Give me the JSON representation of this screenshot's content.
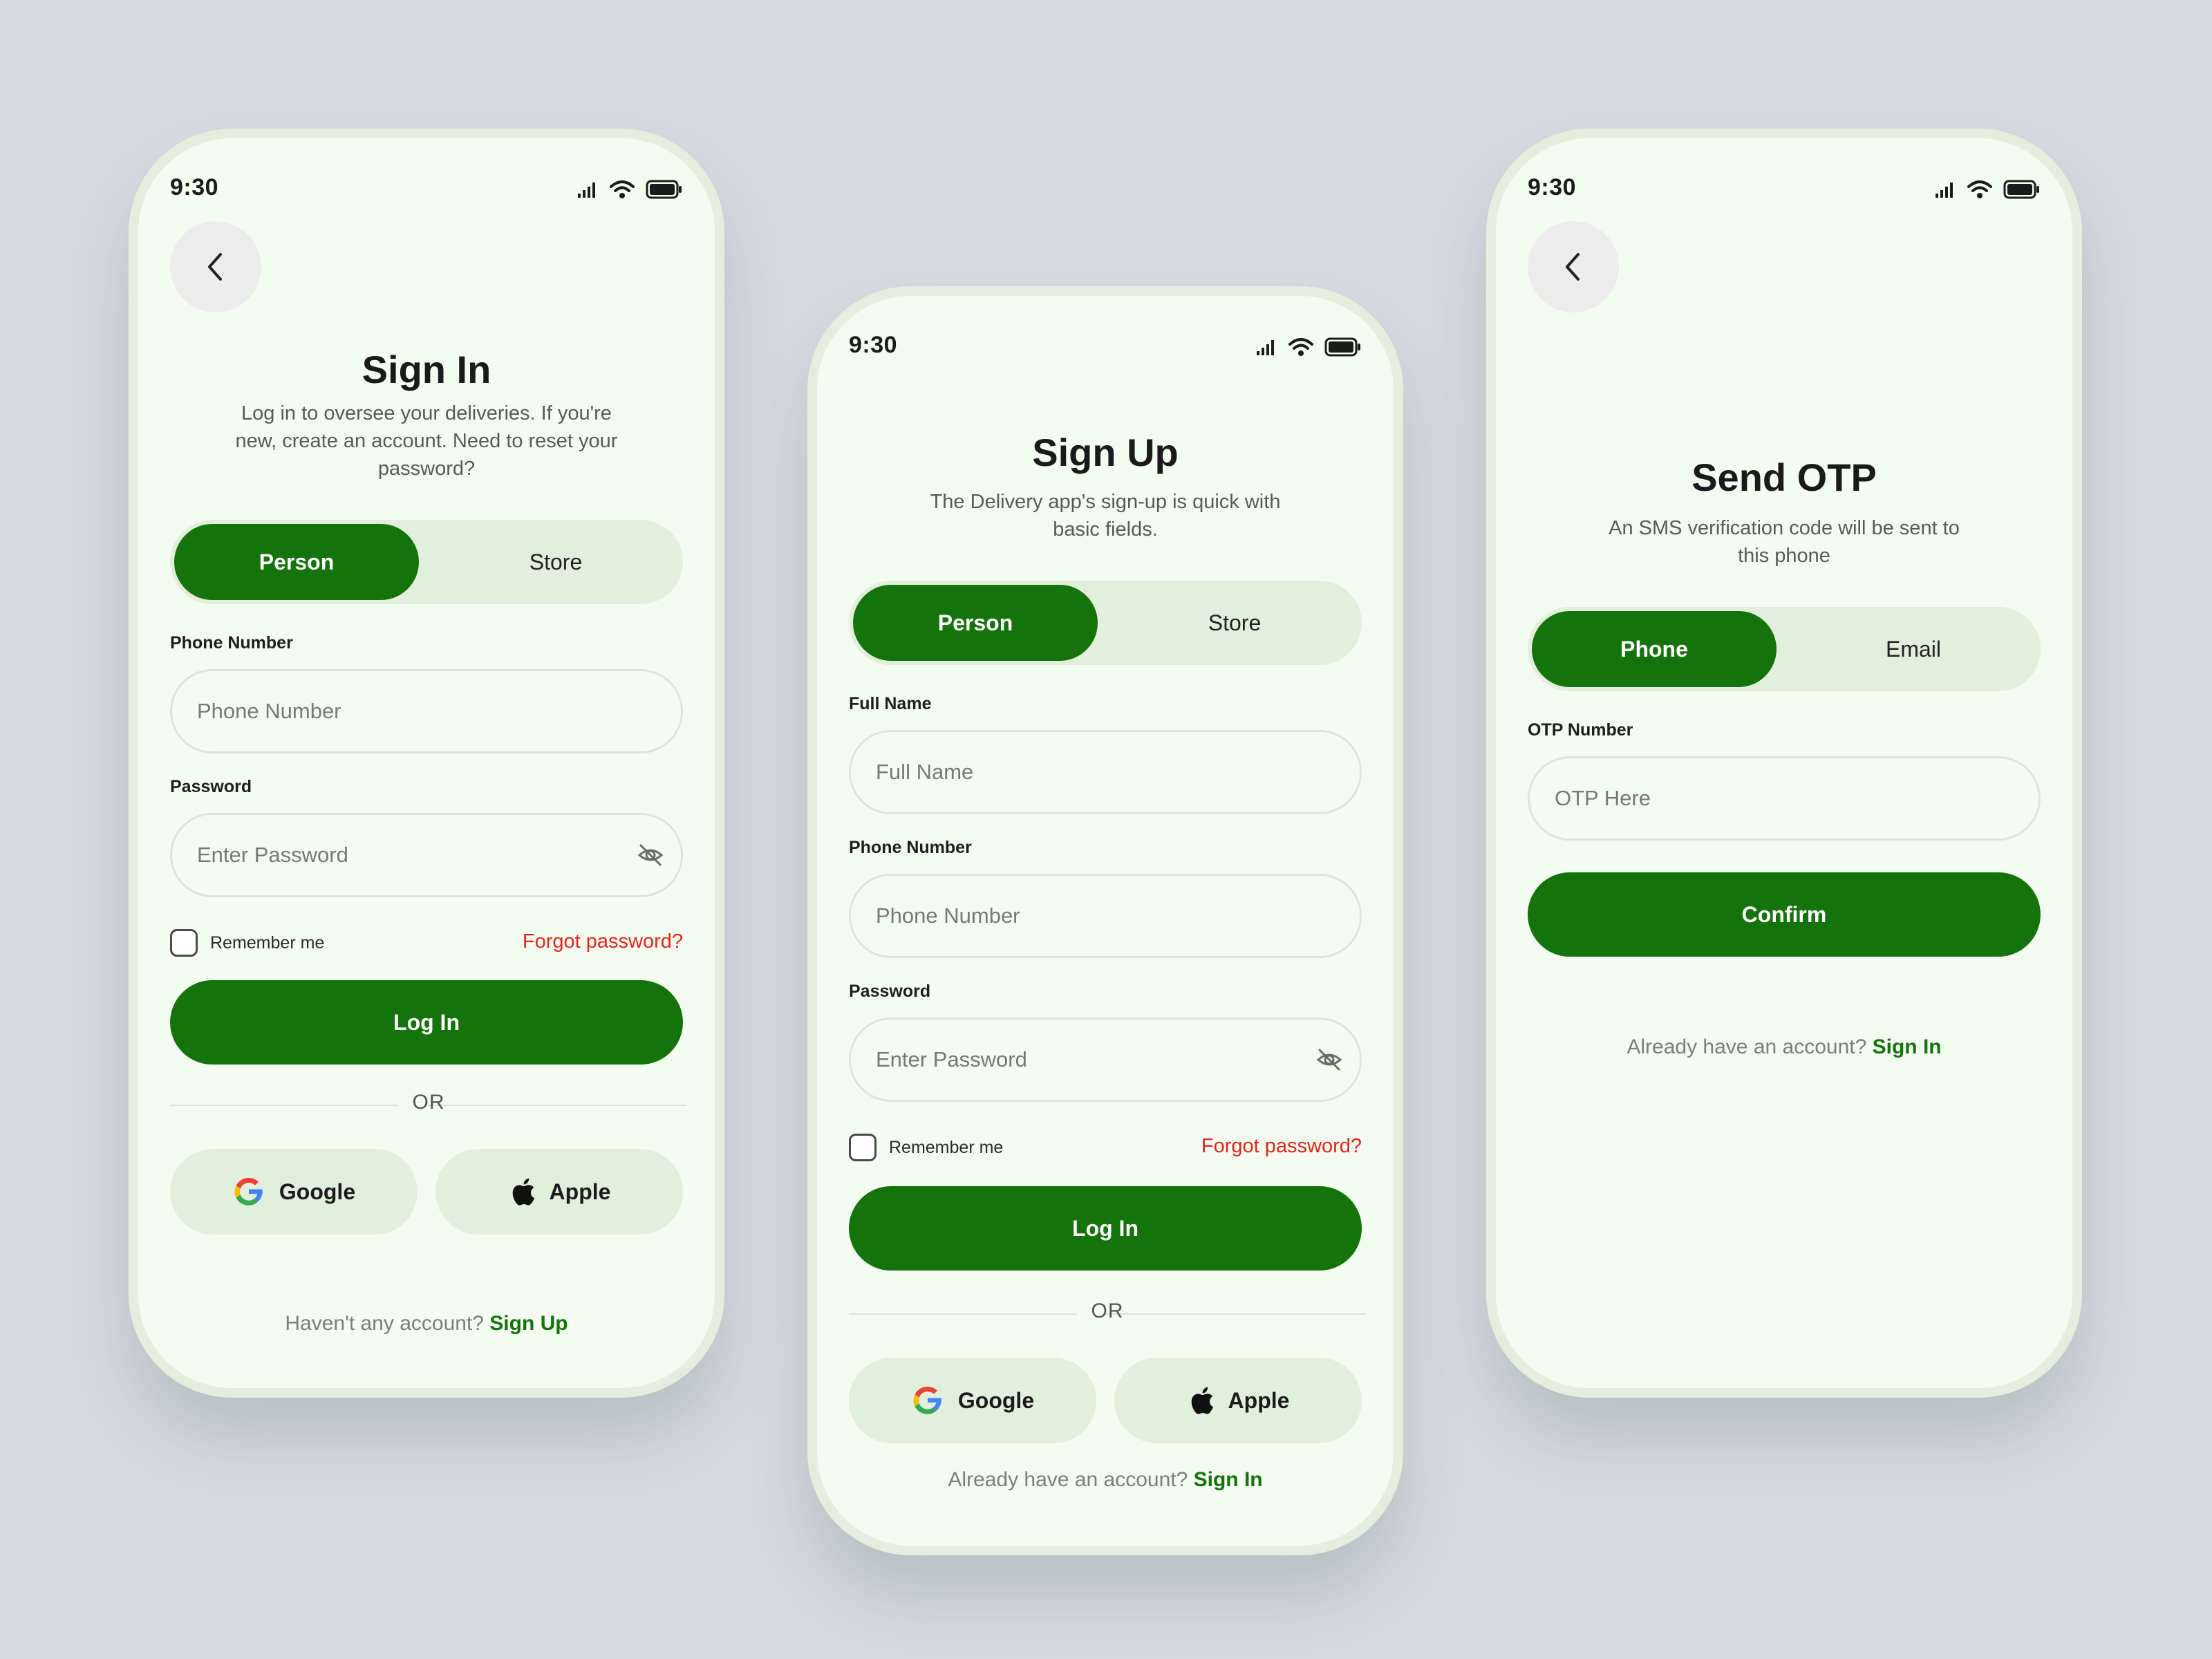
{
  "status_bar": {
    "time": "9:30"
  },
  "colors": {
    "primary": "#14730b",
    "background": "#d4dbe0",
    "screen": "#f4fcf1",
    "segment": "#e3efdd",
    "link_red": "#e0271c"
  },
  "signin": {
    "title": "Sign In",
    "subtitle": "Log in to oversee your deliveries. If you're new, create an account. Need to reset your password?",
    "tabs": [
      "Person",
      "Store"
    ],
    "phone_label": "Phone Number",
    "phone_placeholder": "Phone Number",
    "password_label": "Password",
    "password_placeholder": "Enter Password",
    "remember": "Remember me",
    "forgot": "Forgot password?",
    "login": "Log In",
    "or": "OR",
    "google": "Google",
    "apple": "Apple",
    "footer_text": "Haven't any account?",
    "footer_link": "Sign Up"
  },
  "signup": {
    "title": "Sign Up",
    "subtitle": "The Delivery app's sign-up is quick with basic fields.",
    "tabs": [
      "Person",
      "Store"
    ],
    "name_label": "Full Name",
    "name_placeholder": "Full Name",
    "phone_label": "Phone Number",
    "phone_placeholder": "Phone Number",
    "password_label": "Password",
    "password_placeholder": "Enter Password",
    "remember": "Remember me",
    "forgot": "Forgot password?",
    "login": "Log In",
    "or": "OR",
    "google": "Google",
    "apple": "Apple",
    "footer_text": "Already have an account?",
    "footer_link": "Sign In"
  },
  "otp": {
    "title": "Send OTP",
    "subtitle": "An SMS verification code will be sent to this phone",
    "tabs": [
      "Phone",
      "Email"
    ],
    "otp_label": "OTP Number",
    "otp_placeholder": "OTP Here",
    "confirm": "Confirm",
    "footer_text": "Already have an account?",
    "footer_link": "Sign In"
  },
  "icons": [
    "signal-icon",
    "wifi-icon",
    "battery-icon",
    "back-chevron-icon",
    "eye-off-icon",
    "google-icon",
    "apple-icon"
  ]
}
